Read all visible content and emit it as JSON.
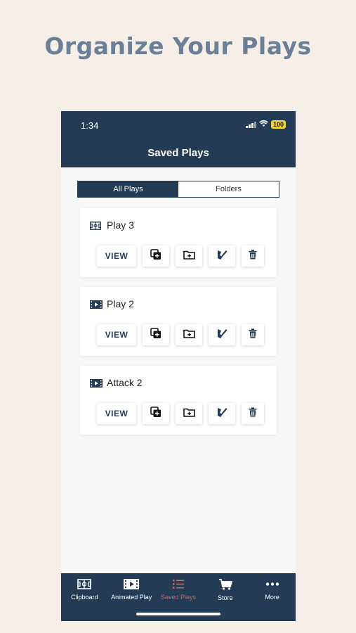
{
  "headline": "Organize Your Plays",
  "status": {
    "time": "1:34",
    "battery": "100"
  },
  "nav": {
    "title": "Saved Plays"
  },
  "segments": [
    {
      "label": "All Plays",
      "active": true
    },
    {
      "label": "Folders",
      "active": false
    }
  ],
  "plays": [
    {
      "title": "Play 3",
      "type_icon": "clipboard-icon",
      "view_label": "VIEW"
    },
    {
      "title": "Play 2",
      "type_icon": "animated-play-icon",
      "view_label": "VIEW"
    },
    {
      "title": "Attack 2",
      "type_icon": "animated-play-icon",
      "view_label": "VIEW"
    }
  ],
  "tabs": [
    {
      "label": "Clipboard",
      "icon": "clipboard-icon"
    },
    {
      "label": "Animated Play",
      "icon": "animated-play-icon"
    },
    {
      "label": "Saved Plays",
      "icon": "list-icon",
      "active": true
    },
    {
      "label": "Store",
      "icon": "cart-icon"
    },
    {
      "label": "More",
      "icon": "more-icon"
    }
  ],
  "colors": {
    "navy": "#243b55",
    "accent": "#c96a5a",
    "background": "#f5efe7",
    "headline": "#6b7f99"
  }
}
